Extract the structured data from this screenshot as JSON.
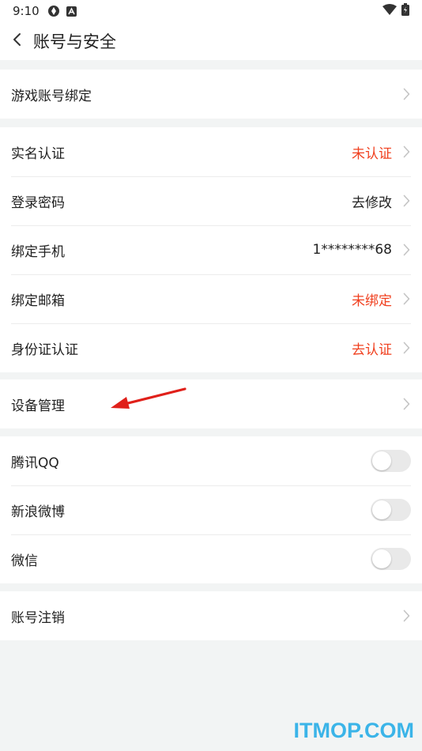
{
  "status_bar": {
    "time": "9:10"
  },
  "header": {
    "title": "账号与安全"
  },
  "groups": {
    "game": {
      "label": "游戏账号绑定"
    },
    "security": {
      "items": [
        {
          "label": "实名认证",
          "value": "未认证",
          "value_color": "#f0401f"
        },
        {
          "label": "登录密码",
          "value": "去修改",
          "value_color": "#222222"
        },
        {
          "label": "绑定手机",
          "value": "1********68",
          "value_color": "#222222"
        },
        {
          "label": "绑定邮箱",
          "value": "未绑定",
          "value_color": "#f0401f"
        },
        {
          "label": "身份证认证",
          "value": "去认证",
          "value_color": "#f0401f"
        }
      ]
    },
    "device": {
      "label": "设备管理"
    },
    "social": {
      "items": [
        {
          "label": "腾讯QQ",
          "enabled": false
        },
        {
          "label": "新浪微博",
          "enabled": false
        },
        {
          "label": "微信",
          "enabled": false
        }
      ]
    },
    "cancel": {
      "label": "账号注销"
    }
  },
  "watermark": "ITMOP.COM",
  "colors": {
    "accent_red": "#f0401f",
    "watermark_blue": "#3bb4e8",
    "background": "#f2f4f4"
  }
}
